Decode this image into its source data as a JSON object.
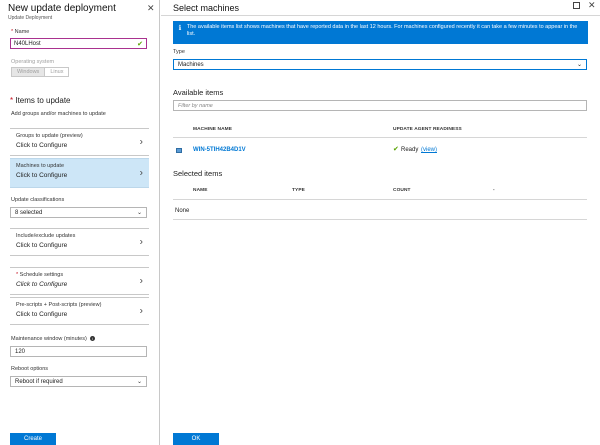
{
  "left_blade": {
    "title": "New update deployment",
    "subtitle": "Update Deployment",
    "close_glyph": "✕",
    "name": {
      "label": "Name",
      "required_mark": "*",
      "value": "N40LHost",
      "valid_glyph": "✔"
    },
    "os": {
      "label": "Operating system",
      "options": [
        "Windows",
        "Linux"
      ],
      "selected": "Windows"
    },
    "items_section": {
      "required_mark": "*",
      "title": "Items to update",
      "description": "Add groups and/or machines to update"
    },
    "groups": {
      "title": "Groups to update (preview)",
      "value": "Click to Configure"
    },
    "machines": {
      "title": "Machines to update",
      "value": "Click to Configure"
    },
    "classifications": {
      "label": "Update classifications",
      "value": "8 selected"
    },
    "include_exclude": {
      "title": "Include/exclude updates",
      "value": "Click to Configure"
    },
    "schedule": {
      "required_mark": "*",
      "title": "Schedule settings",
      "value": "Click to Configure"
    },
    "scripts": {
      "title": "Pre-scripts + Post-scripts (preview)",
      "value": "Click to Configure"
    },
    "maintenance": {
      "label": "Maintenance window (minutes)",
      "value": "120"
    },
    "reboot": {
      "label": "Reboot options",
      "value": "Reboot if required"
    },
    "create_label": "Create",
    "chevron_glyph": "›",
    "dropdown_glyph": "⌄"
  },
  "right_blade": {
    "title": "Select machines",
    "close_glyph": "✕",
    "banner": {
      "icon_glyph": "ℹ",
      "text": "The available items list shows machines that have reported data in the last 12 hours. For machines configured recently it can take a few minutes to appear in the list."
    },
    "type": {
      "label": "Type",
      "value": "Machines"
    },
    "available": {
      "heading": "Available items",
      "filter_placeholder": "Filter by name",
      "columns": [
        "MACHINE NAME",
        "UPDATE AGENT READINESS"
      ],
      "rows": [
        {
          "machine": "WIN-5TIH42B4D1V",
          "readiness": "Ready",
          "link": "(view)"
        }
      ]
    },
    "selected": {
      "heading": "Selected items",
      "columns": [
        "NAME",
        "TYPE",
        "COUNT",
        "-"
      ],
      "empty_text": "None"
    },
    "ok_label": "OK"
  },
  "colors": {
    "accent": "#0078d4",
    "success": "#57a300",
    "active_row": "#cde6f7",
    "name_border": "#a9328f"
  }
}
